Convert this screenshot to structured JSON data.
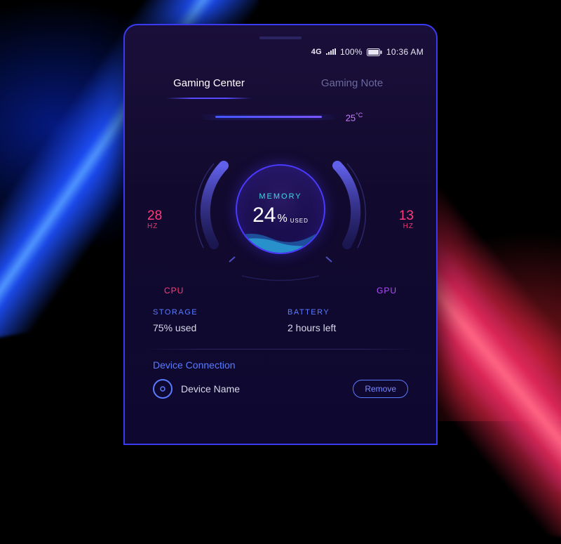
{
  "status": {
    "network": "4G",
    "battery_pct": "100%",
    "time": "10:36 AM"
  },
  "tabs": {
    "active": "Gaming Center",
    "inactive": "Gaming Note"
  },
  "temperature": {
    "value": "25",
    "unit": "°C"
  },
  "gauge": {
    "memory_label": "MEMORY",
    "memory_value": "24",
    "memory_pct": "%",
    "memory_used": "USED",
    "cpu_value": "28",
    "cpu_unit": "HZ",
    "cpu_label": "CPU",
    "gpu_value": "13",
    "gpu_unit": "HZ",
    "gpu_label": "GPU"
  },
  "info": {
    "storage_label": "STORAGE",
    "storage_value": "75% used",
    "battery_label": "BATTERY",
    "battery_value": "2 hours left"
  },
  "connection": {
    "title": "Device Connection",
    "device_name": "Device Name",
    "remove_label": "Remove"
  },
  "colors": {
    "accent_blue": "#5a7bff",
    "accent_pink": "#ff3b7b",
    "accent_purple": "#b84bff",
    "accent_cyan": "#3dd9e8"
  }
}
